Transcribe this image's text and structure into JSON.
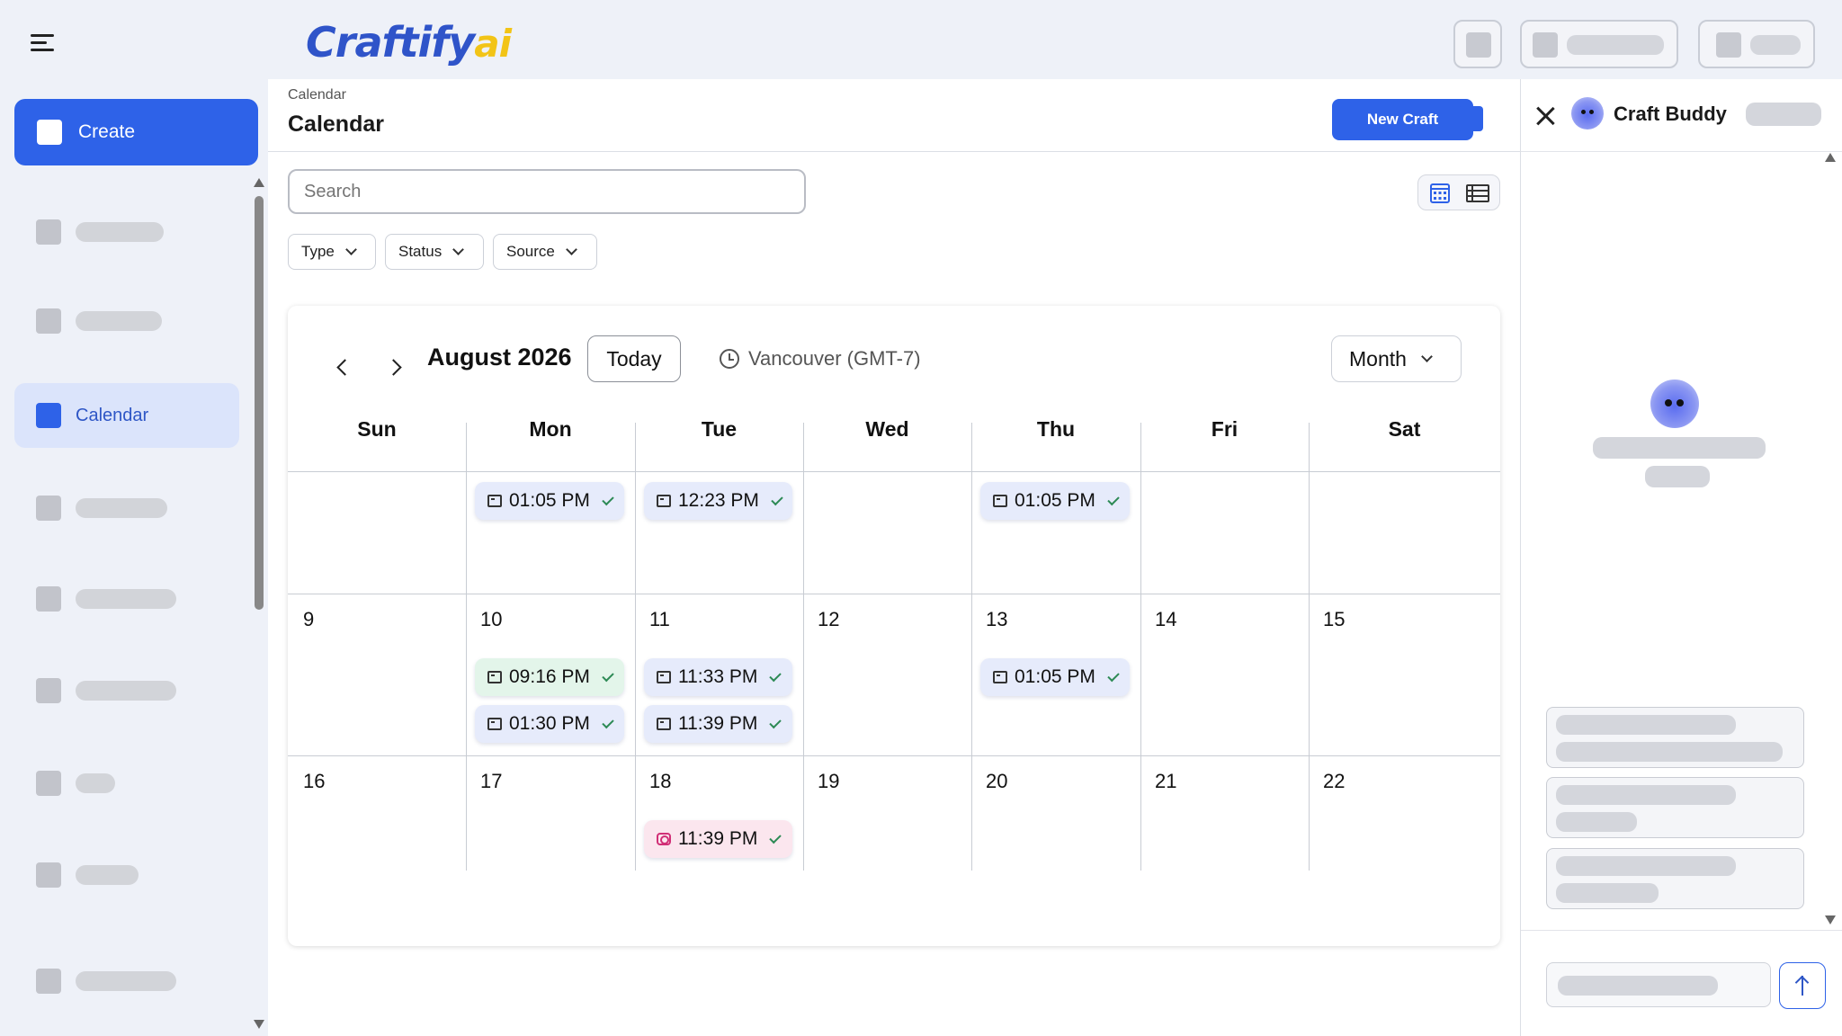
{
  "app": {
    "logo_main": "Craftify",
    "logo_suffix": "ai"
  },
  "sidebar": {
    "create_label": "Create",
    "active_item_label": "Calendar"
  },
  "header": {
    "breadcrumb": "Calendar",
    "title": "Calendar",
    "new_craft_label": "New Craft"
  },
  "search": {
    "placeholder": "Search"
  },
  "filters": [
    "Type",
    "Status",
    "Source"
  ],
  "calendar": {
    "month_label": "August 2026",
    "today_label": "Today",
    "timezone": "Vancouver (GMT-7)",
    "view_mode": "Month",
    "weekdays": [
      "Sun",
      "Mon",
      "Tue",
      "Wed",
      "Thu",
      "Fri",
      "Sat"
    ],
    "weeks": [
      [
        "",
        "",
        "",
        "",
        "",
        "",
        ""
      ],
      [
        "9",
        "10",
        "11",
        "12",
        "13",
        "14",
        "15"
      ],
      [
        "16",
        "17",
        "18",
        "19",
        "20",
        "21",
        "22"
      ]
    ],
    "events": [
      {
        "week": 0,
        "day": 1,
        "slot": 0,
        "time": "01:05 PM",
        "style": "blue",
        "icon": "post-icon",
        "status": "done"
      },
      {
        "week": 0,
        "day": 2,
        "slot": 0,
        "time": "12:23 PM",
        "style": "blue",
        "icon": "post-icon",
        "status": "done"
      },
      {
        "week": 0,
        "day": 4,
        "slot": 0,
        "time": "01:05 PM",
        "style": "blue",
        "icon": "post-icon",
        "status": "done"
      },
      {
        "week": 1,
        "day": 1,
        "slot": 0,
        "time": "09:16 PM",
        "style": "green",
        "icon": "post-icon",
        "status": "done"
      },
      {
        "week": 1,
        "day": 1,
        "slot": 1,
        "time": "01:30 PM",
        "style": "blue",
        "icon": "post-icon",
        "status": "done"
      },
      {
        "week": 1,
        "day": 2,
        "slot": 0,
        "time": "11:33 PM",
        "style": "blue",
        "icon": "post-icon",
        "status": "done"
      },
      {
        "week": 1,
        "day": 2,
        "slot": 1,
        "time": "11:39 PM",
        "style": "blue",
        "icon": "post-icon",
        "status": "done"
      },
      {
        "week": 1,
        "day": 4,
        "slot": 0,
        "time": "01:05 PM",
        "style": "blue",
        "icon": "post-icon",
        "status": "done"
      },
      {
        "week": 2,
        "day": 2,
        "slot": 0,
        "time": "11:39 PM",
        "style": "pink",
        "icon": "instagram-icon",
        "status": "done"
      }
    ]
  },
  "assistant": {
    "name": "Craft Buddy"
  },
  "colors": {
    "accent": "#2e62e8",
    "event_blue": "#e6ebfb",
    "event_green": "#e3f5ea",
    "event_pink": "#fbe6ee",
    "check": "#2d8a55"
  }
}
